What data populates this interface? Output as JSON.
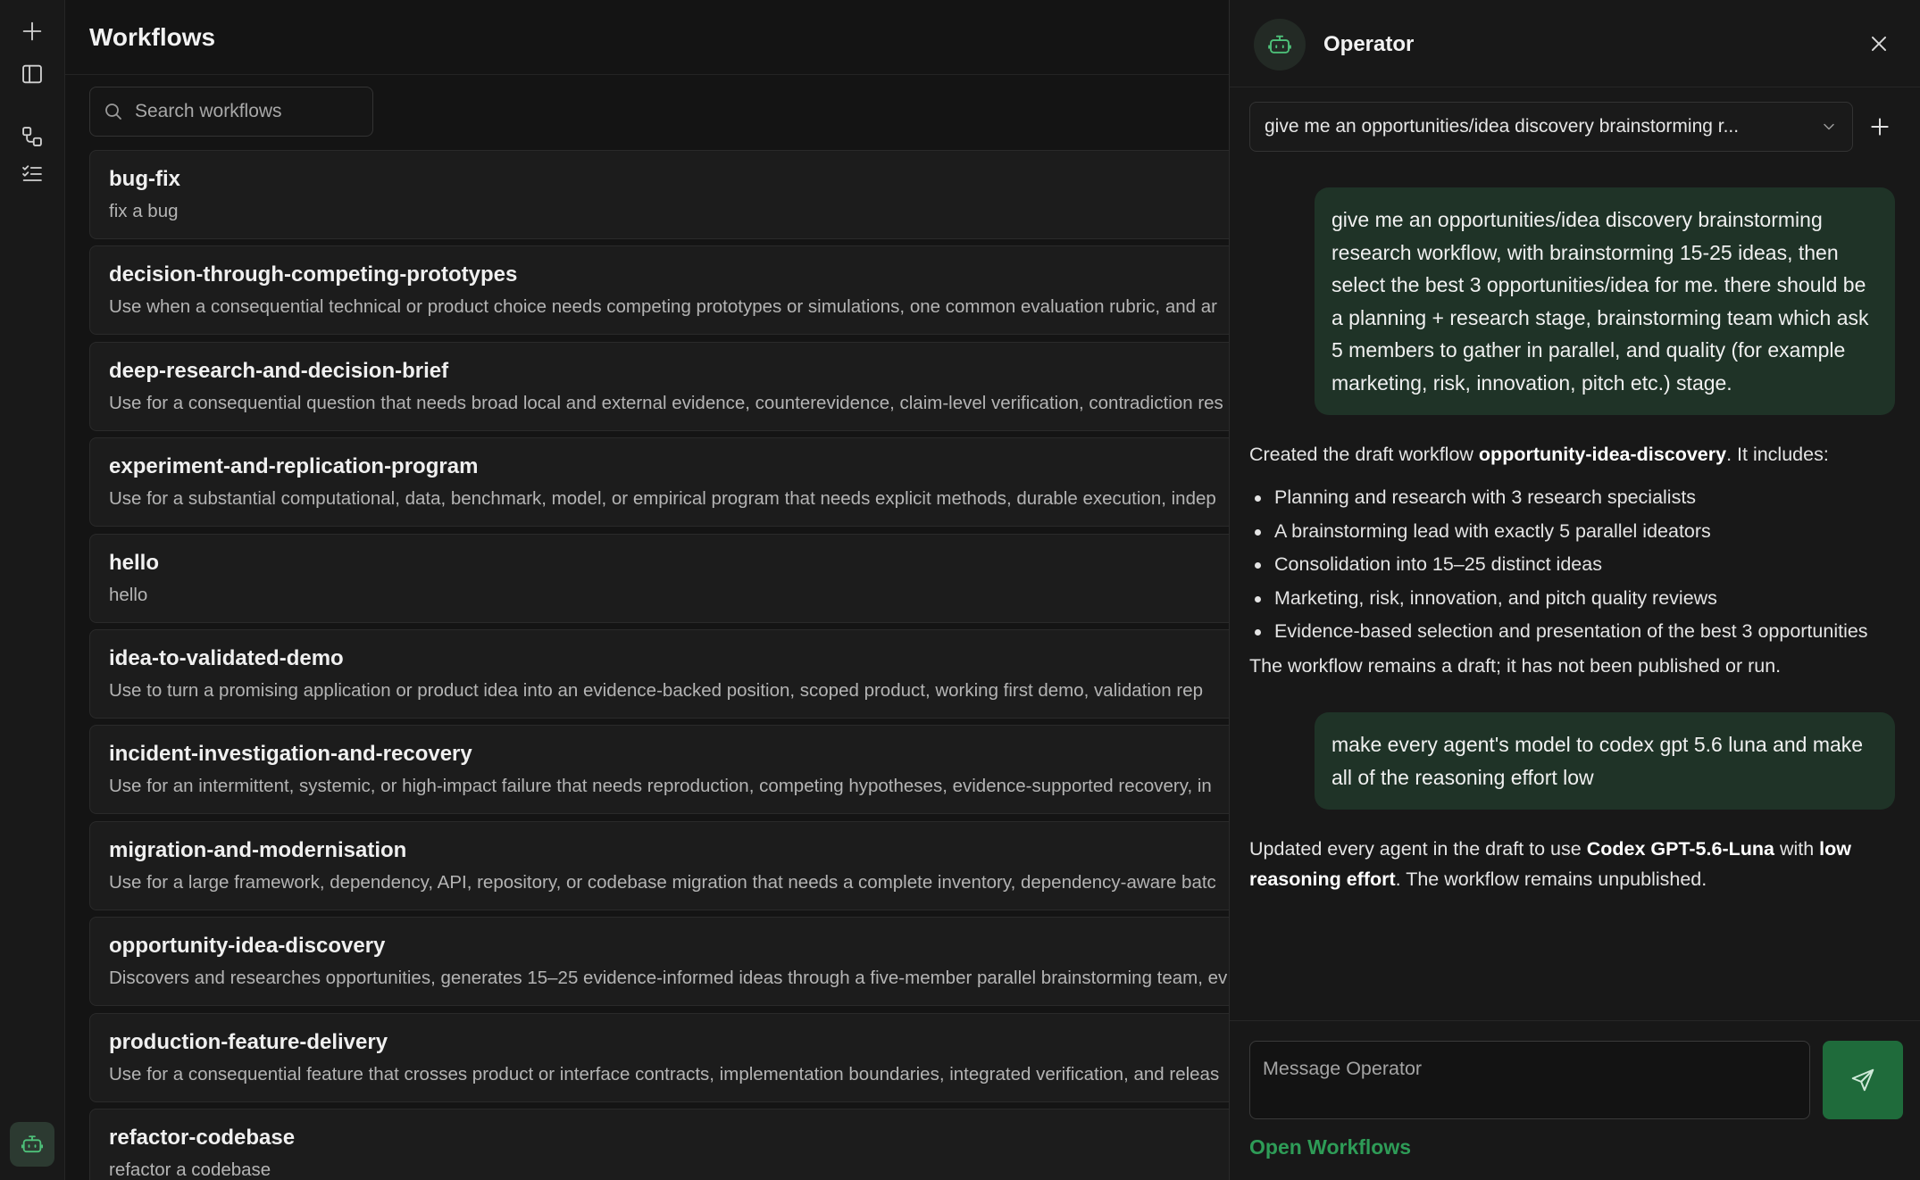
{
  "rail": {
    "icons": [
      "plus-icon",
      "sidebar-toggle-icon",
      "workflows-icon",
      "checklist-icon",
      "operator-bot-icon"
    ]
  },
  "main": {
    "title": "Workflows",
    "search": {
      "placeholder": "Search workflows",
      "value": ""
    },
    "workflows": [
      {
        "name": "bug-fix",
        "description": "fix a bug"
      },
      {
        "name": "decision-through-competing-prototypes",
        "description": "Use when a consequential technical or product choice needs competing prototypes or simulations, one common evaluation rubric, and ar"
      },
      {
        "name": "deep-research-and-decision-brief",
        "description": "Use for a consequential question that needs broad local and external evidence, counterevidence, claim-level verification, contradiction res"
      },
      {
        "name": "experiment-and-replication-program",
        "description": "Use for a substantial computational, data, benchmark, model, or empirical program that needs explicit methods, durable execution, indep"
      },
      {
        "name": "hello",
        "description": "hello"
      },
      {
        "name": "idea-to-validated-demo",
        "description": "Use to turn a promising application or product idea into an evidence-backed position, scoped product, working first demo, validation rep"
      },
      {
        "name": "incident-investigation-and-recovery",
        "description": "Use for an intermittent, systemic, or high-impact failure that needs reproduction, competing hypotheses, evidence-supported recovery, in"
      },
      {
        "name": "migration-and-modernisation",
        "description": "Use for a large framework, dependency, API, repository, or codebase migration that needs a complete inventory, dependency-aware batc"
      },
      {
        "name": "opportunity-idea-discovery",
        "description": "Discovers and researches opportunities, generates 15–25 evidence-informed ideas through a five-member parallel brainstorming team, ev"
      },
      {
        "name": "production-feature-delivery",
        "description": "Use for a consequential feature that crosses product or interface contracts, implementation boundaries, integrated verification, and releas"
      },
      {
        "name": "refactor-codebase",
        "description": "refactor a codebase"
      }
    ]
  },
  "operator": {
    "title": "Operator",
    "session_title": "give me an opportunities/idea discovery brainstorming r...",
    "messages": {
      "user_1": "give me an opportunities/idea discovery brainstorming research workflow, with brainstorming 15-25 ideas, then select the best 3 opportunities/idea for me. there should be a planning + research stage, brainstorming team which ask 5 members to gather in parallel, and quality (for example marketing, risk, innovation, pitch etc.) stage.",
      "assistant_1": {
        "intro_before": "Created the draft workflow ",
        "intro_bold": "opportunity-idea-discovery",
        "intro_after": ". It includes:",
        "bullets": [
          "Planning and research with 3 research specialists",
          "A brainstorming lead with exactly 5 parallel ideators",
          "Consolidation into 15–25 distinct ideas",
          "Marketing, risk, innovation, and pitch quality reviews",
          "Evidence-based selection and presentation of the best 3 opportunities"
        ],
        "outro": "The workflow remains a draft; it has not been published or run."
      },
      "user_2": "make every agent's model to codex gpt 5.6 luna and make all of the reasoning effort low",
      "assistant_2": {
        "part1": "Updated every agent in the draft to use ",
        "bold1": "Codex GPT-5.6-Luna",
        "part2": " with ",
        "bold2": "low reasoning effort",
        "part3": ". The workflow remains unpublished."
      }
    },
    "composer": {
      "placeholder": "Message Operator",
      "value": ""
    },
    "open_link": "Open Workflows"
  },
  "colors": {
    "background": "#141414",
    "accent": "#2e9c57",
    "user_bubble": "#1f3327",
    "send_button": "#1f6b3b"
  }
}
